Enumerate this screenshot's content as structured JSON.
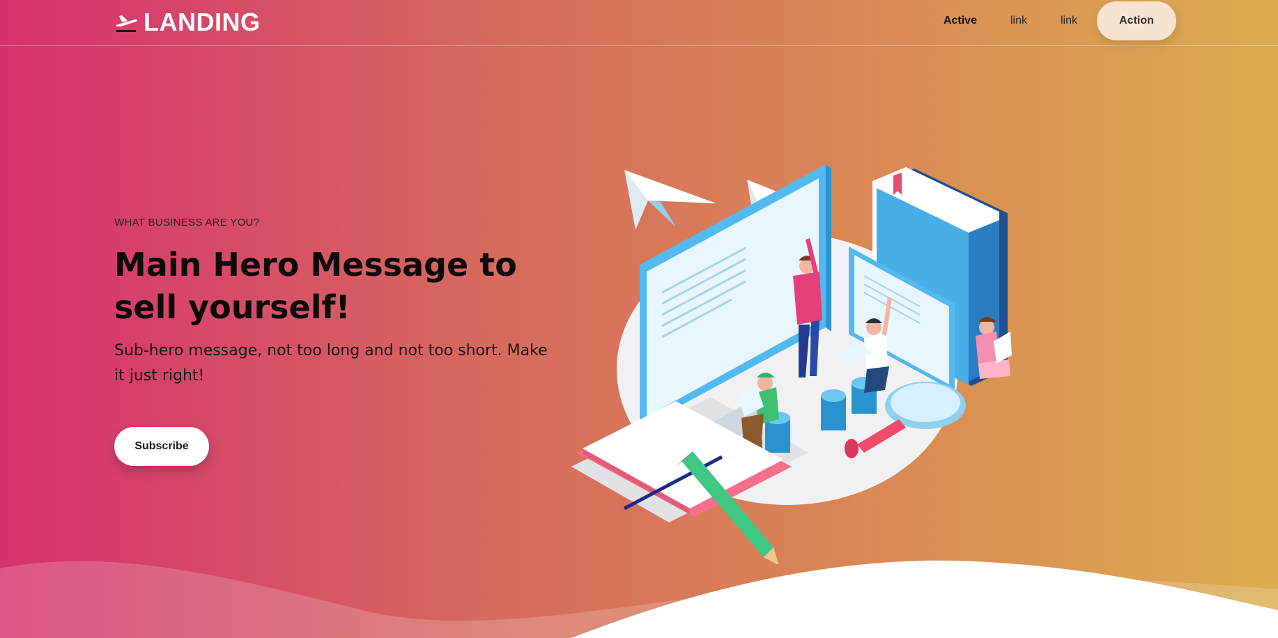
{
  "header": {
    "brand": "LANDING",
    "brand_icon": "airplane-takeoff-icon",
    "nav": [
      {
        "label": "Active",
        "active": true
      },
      {
        "label": "link",
        "active": false
      },
      {
        "label": "link",
        "active": false
      }
    ],
    "action_label": "Action"
  },
  "hero": {
    "eyebrow": "WHAT BUSINESS ARE YOU?",
    "title": "Main Hero Message to sell yourself!",
    "subtitle": "Sub-hero message, not too long and not too short. Make it just right!",
    "subscribe_label": "Subscribe"
  },
  "colors": {
    "gradient_start": "#d5306f",
    "gradient_end": "#dcad50",
    "action_bg": "#f6e4d1",
    "subscribe_bg": "#ffffff"
  }
}
